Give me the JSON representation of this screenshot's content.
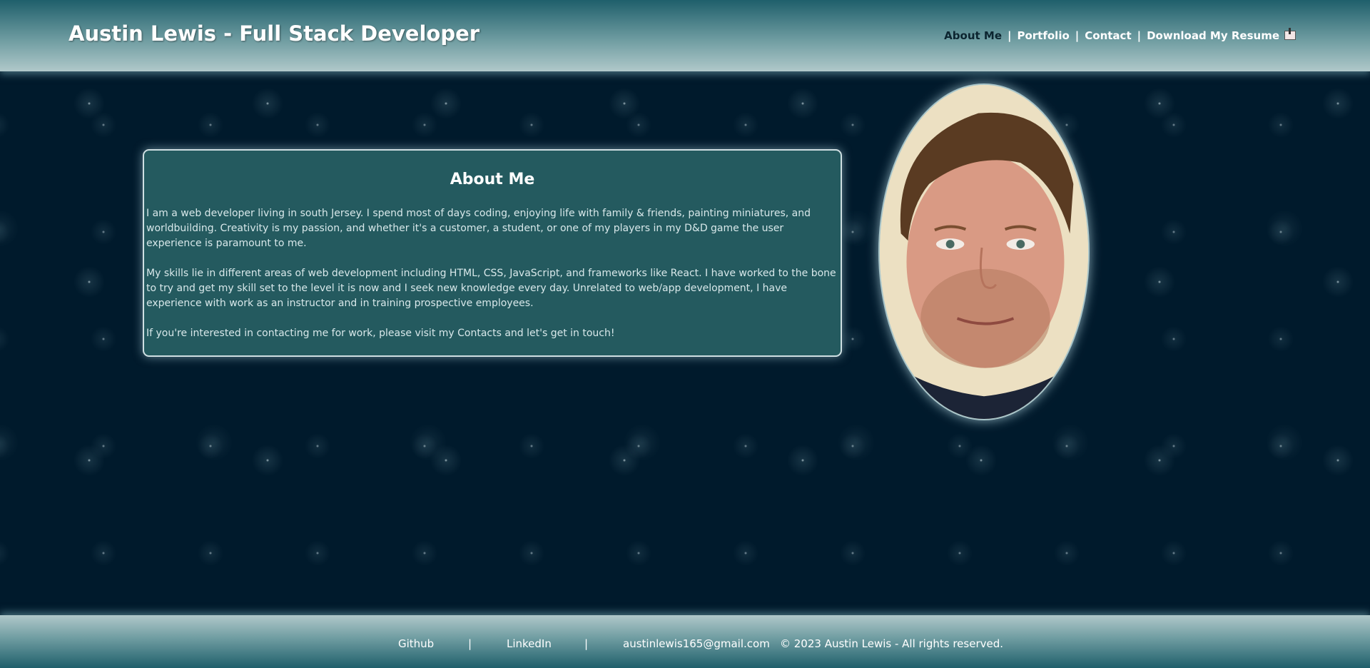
{
  "header": {
    "title": "Austin Lewis - Full Stack Developer",
    "nav": [
      {
        "label": "About Me",
        "active": true
      },
      {
        "label": "Portfolio",
        "active": false
      },
      {
        "label": "Contact",
        "active": false
      },
      {
        "label": "Download My Resume",
        "active": false,
        "icon": "download-icon"
      }
    ],
    "separator": "|"
  },
  "about": {
    "heading": "About Me",
    "paragraphs": [
      "I am a web developer living in south Jersey. I spend most of days coding, enjoying life with family & friends, painting miniatures, and worldbuilding. Creativity is my passion, and whether it's a customer, a student, or one of my players in my D&D game the user experience is paramount to me.",
      "My skills lie in different areas of web development including HTML, CSS, JavaScript, and frameworks like React. I have worked to the bone to try and get my skill set to the level it is now and I seek new knowledge every day. Unrelated to web/app development, I have experience with work as an instructor and in training prospective employees.",
      "If you're interested in contacting me for work, please visit my Contacts and let's get in touch!"
    ]
  },
  "footer": {
    "github": "Github",
    "linkedin": "LinkedIn",
    "separator": "|",
    "email": "austinlewis165@gmail.com",
    "copyright": "© 2023 Austin Lewis - All rights reserved."
  },
  "colors": {
    "background": "#001a2c",
    "card": "#245a5f",
    "header_top": "#1f5f6b",
    "header_bottom": "#b0c8ca"
  }
}
